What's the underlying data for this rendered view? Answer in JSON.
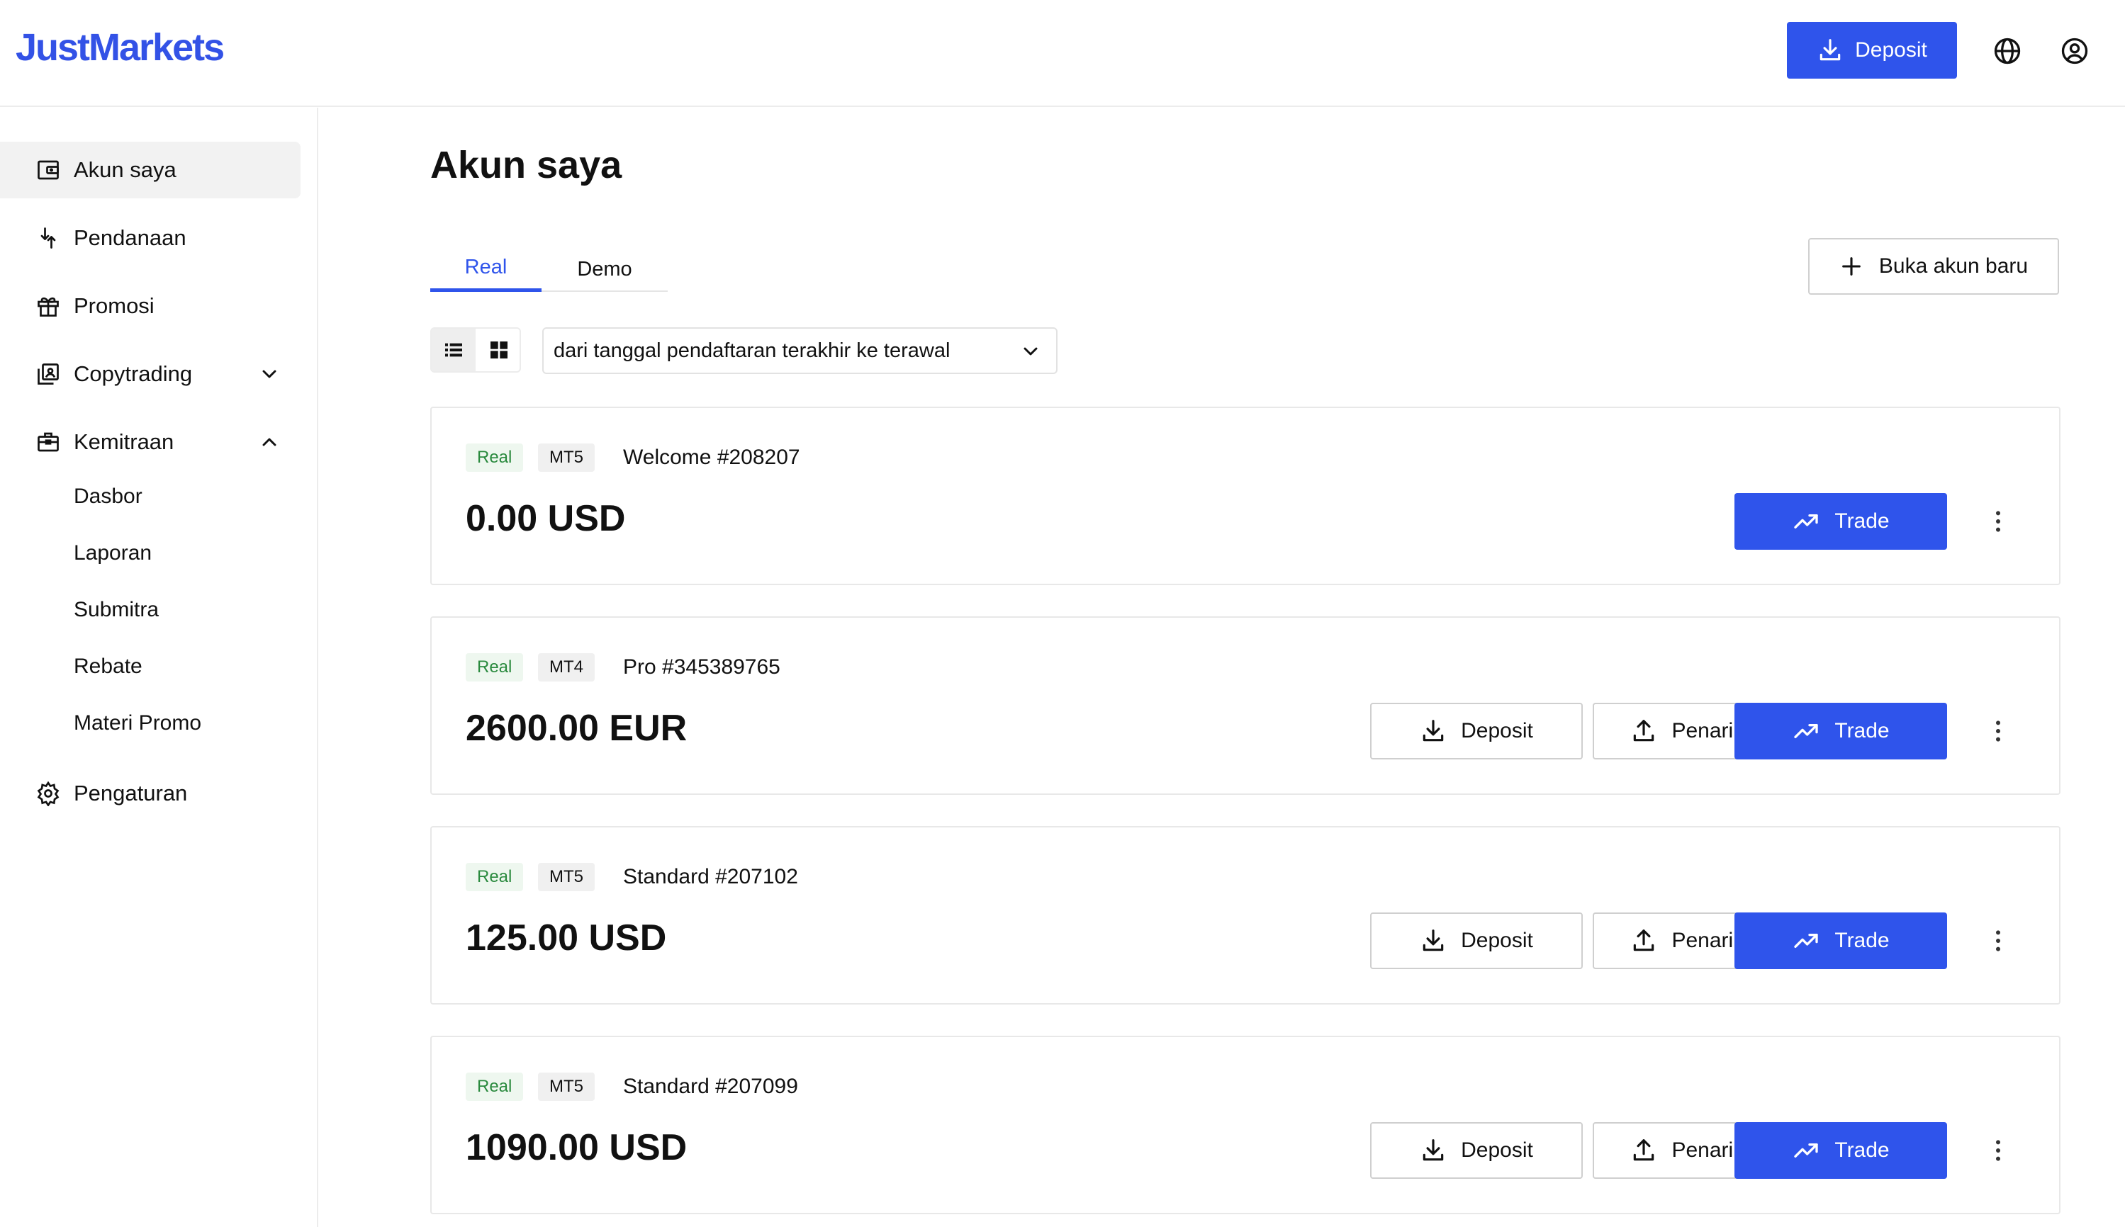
{
  "header": {
    "logo": "JustMarkets",
    "deposit_label": "Deposit",
    "icons": [
      "download-icon",
      "globe-icon",
      "user-icon"
    ]
  },
  "sidebar": {
    "items": [
      {
        "label": "Akun saya",
        "icon": "wallet-icon",
        "active": true
      },
      {
        "label": "Pendanaan",
        "icon": "transfer-icon"
      },
      {
        "label": "Promosi",
        "icon": "gift-icon"
      },
      {
        "label": "Copytrading",
        "icon": "copytrading-icon",
        "expanded": false
      },
      {
        "label": "Kemitraan",
        "icon": "briefcase-icon",
        "expanded": true
      },
      {
        "label": "Pengaturan",
        "icon": "gear-icon"
      }
    ],
    "kemitraan_sub": [
      "Dasbor",
      "Laporan",
      "Submitra",
      "Rebate",
      "Materi Promo"
    ]
  },
  "main": {
    "title": "Akun saya",
    "tabs": [
      {
        "label": "Real",
        "active": true
      },
      {
        "label": "Demo"
      }
    ],
    "new_account_label": "Buka akun baru",
    "sort_label": "dari tanggal pendaftaran terakhir ke terawal",
    "view_mode": "list",
    "action_labels": {
      "deposit": "Deposit",
      "withdraw": "Penarikan",
      "trade": "Trade"
    },
    "accounts": [
      {
        "type": "Real",
        "platform": "MT5",
        "name": "Welcome #208207",
        "balance": "0.00 USD",
        "actions": [
          "trade"
        ]
      },
      {
        "type": "Real",
        "platform": "MT4",
        "name": "Pro #345389765",
        "balance": "2600.00 EUR",
        "actions": [
          "deposit",
          "withdraw",
          "trade"
        ]
      },
      {
        "type": "Real",
        "platform": "MT5",
        "name": "Standard #207102",
        "balance": "125.00 USD",
        "actions": [
          "deposit",
          "withdraw",
          "trade"
        ]
      },
      {
        "type": "Real",
        "platform": "MT5",
        "name": "Standard #207099",
        "balance": "1090.00 USD",
        "actions": [
          "deposit",
          "withdraw",
          "trade"
        ]
      }
    ]
  },
  "colors": {
    "accent": "#2f54eb",
    "logo": "#3352e6",
    "real_badge_text": "#2a8a3e",
    "real_badge_bg": "#eef7ef"
  }
}
